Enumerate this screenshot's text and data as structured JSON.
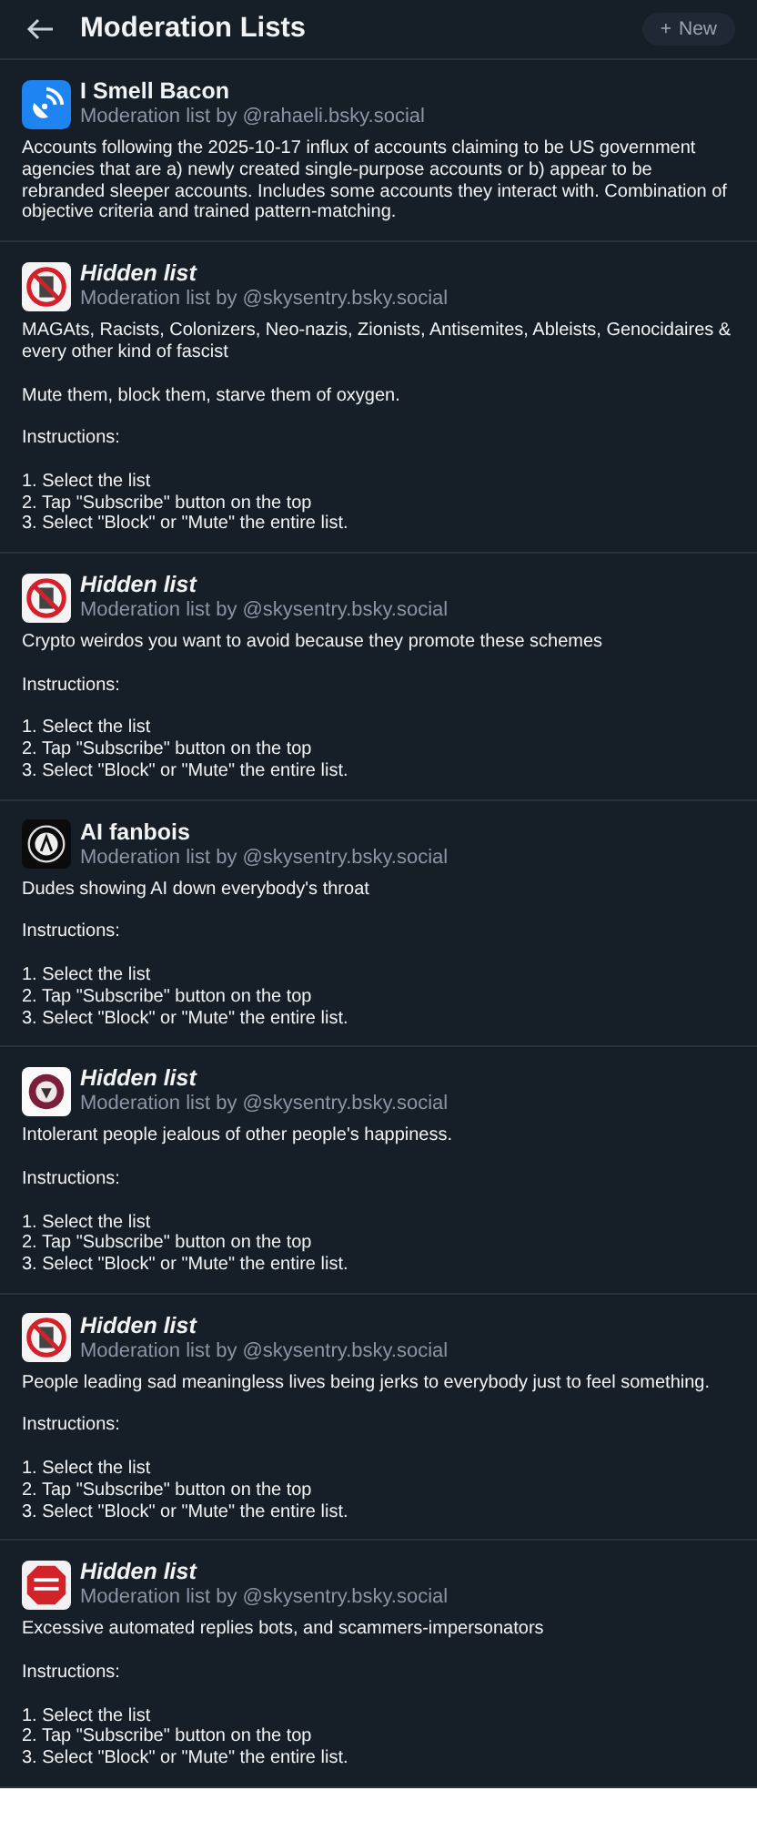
{
  "header": {
    "title": "Moderation Lists",
    "new_button": {
      "plus": "+",
      "label": "New"
    }
  },
  "lists": [
    {
      "kind": "antenna",
      "title": "I Smell Bacon",
      "hidden": false,
      "byline": "Moderation list by @rahaeli.bsky.social",
      "paragraphs": [
        "Accounts following the 2025-10-17 influx of accounts claiming to be US government agencies that are a) newly created single-purpose accounts or b) appear to be rebranded sleeper accounts. Includes some accounts they interact with. Combination of objective criteria and trained pattern-matching."
      ]
    },
    {
      "kind": "prohibited",
      "title": "Hidden list",
      "hidden": true,
      "byline": "Moderation list by @skysentry.bsky.social",
      "paragraphs": [
        "MAGAts, Racists, Colonizers, Neo-nazis, Zionists, Antisemites, Ableists, Genocidaires & every other kind of fascist",
        "Mute them, block them, starve them of oxygen.",
        "Instructions:",
        "1. Select the list\n2. Tap \"Subscribe\" button on the top\n3. Select \"Block\" or \"Mute\" the entire list."
      ]
    },
    {
      "kind": "prohibited",
      "title": "Hidden list",
      "hidden": true,
      "byline": "Moderation list by @skysentry.bsky.social",
      "paragraphs": [
        "Crypto weirdos you want to avoid because they promote these schemes",
        "Instructions:",
        "1. Select the list\n2. Tap \"Subscribe\" button on the top\n3. Select \"Block\" or \"Mute\" the entire list."
      ]
    },
    {
      "kind": "emblem",
      "title": "AI fanbois",
      "hidden": false,
      "byline": "Moderation list by @skysentry.bsky.social",
      "paragraphs": [
        "Dudes showing AI down everybody's throat",
        "Instructions:",
        "1. Select the list\n2. Tap \"Subscribe\" button on the top\n3. Select \"Block\" or \"Mute\" the entire list."
      ]
    },
    {
      "kind": "badge",
      "title": "Hidden list",
      "hidden": true,
      "byline": "Moderation list by @skysentry.bsky.social",
      "paragraphs": [
        "Intolerant people jealous of other people's happiness.",
        "Instructions:",
        "1. Select the list\n2. Tap \"Subscribe\" button on the top\n3. Select \"Block\" or \"Mute\" the entire list."
      ]
    },
    {
      "kind": "prohibited",
      "title": "Hidden list",
      "hidden": true,
      "byline": "Moderation list by @skysentry.bsky.social",
      "paragraphs": [
        "People leading sad meaningless lives being jerks to everybody just to feel something.",
        "Instructions:",
        "1. Select the list\n2. Tap \"Subscribe\" button on the top\n3. Select \"Block\" or \"Mute\" the entire list."
      ]
    },
    {
      "kind": "stop",
      "title": "Hidden list",
      "hidden": true,
      "byline": "Moderation list by @skysentry.bsky.social",
      "paragraphs": [
        "Excessive automated replies bots, and scammers-impersonators",
        "Instructions:",
        "1. Select the list\n2. Tap \"Subscribe\" button on the top\n3. Select \"Block\" or \"Mute\" the entire list."
      ]
    }
  ]
}
